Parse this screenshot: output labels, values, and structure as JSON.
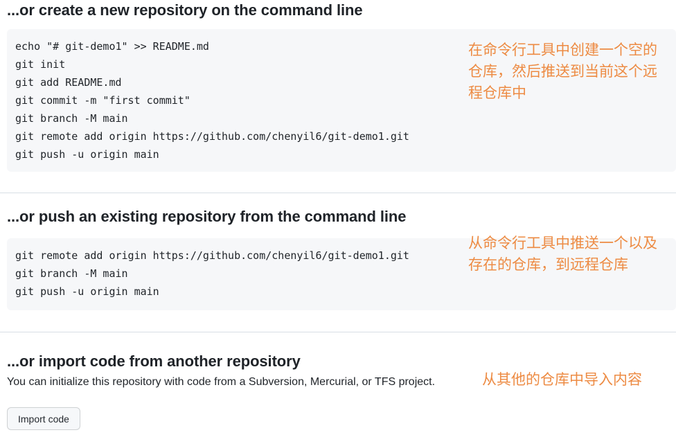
{
  "sections": [
    {
      "id": "create",
      "heading": "...or create a new repository on the command line",
      "code_lines": [
        "echo \"# git-demo1\" >> README.md",
        "git init",
        "git add README.md",
        "git commit -m \"first commit\"",
        "git branch -M main",
        "git remote add origin https://github.com/chenyil6/git-demo1.git",
        "git push -u origin main"
      ],
      "annotation": "在命令行工具中创建一个空的仓库，然后推送到当前这个远程仓库中"
    },
    {
      "id": "push",
      "heading": "...or push an existing repository from the command line",
      "code_lines": [
        "git remote add origin https://github.com/chenyil6/git-demo1.git",
        "git branch -M main",
        "git push -u origin main"
      ],
      "annotation": "从命令行工具中推送一个以及存在的仓库，到远程仓库"
    },
    {
      "id": "import",
      "heading": "...or import code from another repository",
      "subtext": "You can initialize this repository with code from a Subversion, Mercurial, or TFS project.",
      "button_label": "Import code",
      "annotation": "从其他的仓库中导入内容"
    }
  ],
  "colors": {
    "annotation": "#ed8b43",
    "code_background": "#f6f7f9",
    "heading_text": "#1f2328",
    "divider": "#d8dee4",
    "button_background": "#f6f8fa"
  }
}
